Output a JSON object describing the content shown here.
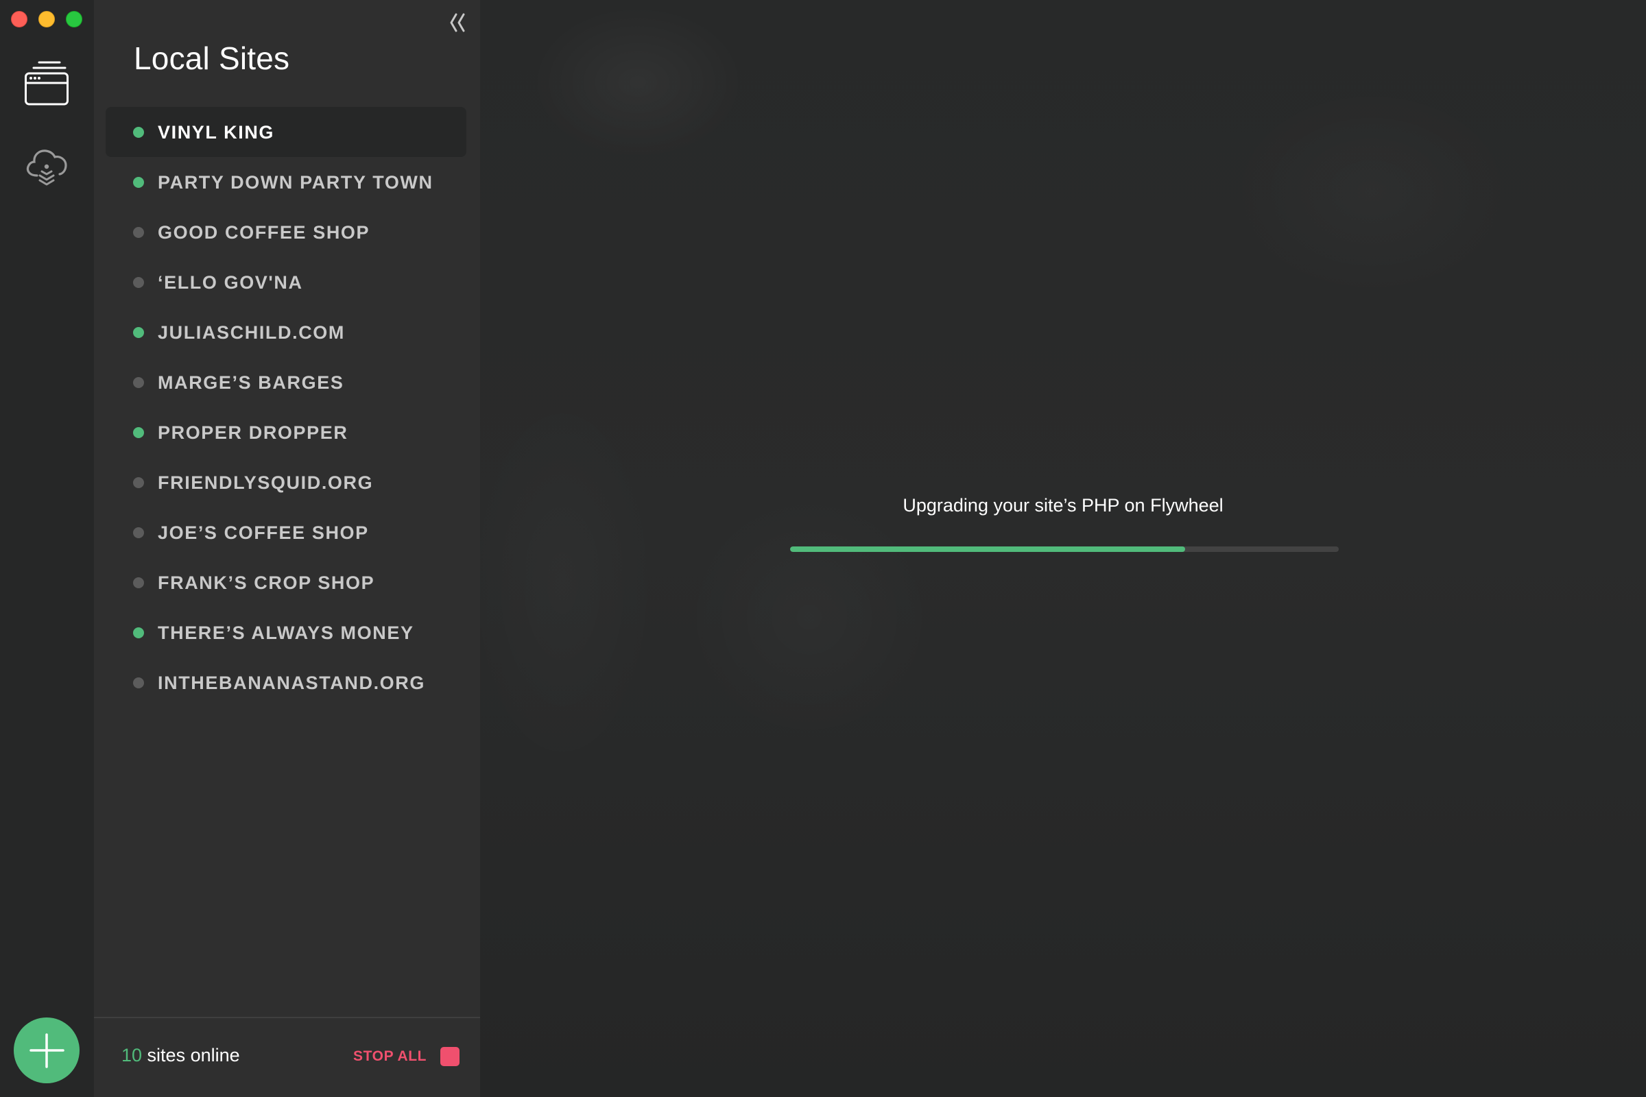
{
  "window": {
    "controls": [
      "close",
      "minimize",
      "maximize"
    ]
  },
  "rail": {
    "items": [
      {
        "name": "local-sites",
        "icon": "sites-stack-icon",
        "active": true
      },
      {
        "name": "connect",
        "icon": "cloud-download-icon",
        "active": false
      }
    ],
    "add_button_icon": "plus-icon"
  },
  "panel": {
    "title": "Local Sites",
    "collapse_icon": "double-chevron-left-icon",
    "sites": [
      {
        "label": "VINYL KING",
        "online": true,
        "selected": true
      },
      {
        "label": "PARTY DOWN PARTY TOWN",
        "online": true,
        "selected": false
      },
      {
        "label": "GOOD COFFEE SHOP",
        "online": false,
        "selected": false
      },
      {
        "label": "‘ELLO GOV'NA",
        "online": false,
        "selected": false
      },
      {
        "label": "JULIASCHILD.COM",
        "online": true,
        "selected": false
      },
      {
        "label": "MARGE’S BARGES",
        "online": false,
        "selected": false
      },
      {
        "label": "PROPER DROPPER",
        "online": true,
        "selected": false
      },
      {
        "label": "FRIENDLYSQUID.ORG",
        "online": false,
        "selected": false
      },
      {
        "label": "JOE’S COFFEE SHOP",
        "online": false,
        "selected": false
      },
      {
        "label": "FRANK’S CROP SHOP",
        "online": false,
        "selected": false
      },
      {
        "label": "THERE’S ALWAYS MONEY",
        "online": true,
        "selected": false
      },
      {
        "label": "INTHEBANANASTAND.ORG",
        "online": false,
        "selected": false
      }
    ],
    "footer": {
      "online_count": "10",
      "online_suffix": " sites online",
      "stop_all_label": "STOP ALL"
    }
  },
  "main": {
    "status_text": "Upgrading your site’s PHP on Flywheel",
    "progress_fraction": 0.72
  },
  "colors": {
    "accent_green": "#51bb7b",
    "offline_gray": "#5c5c5c",
    "stop_red": "#f0506e"
  }
}
